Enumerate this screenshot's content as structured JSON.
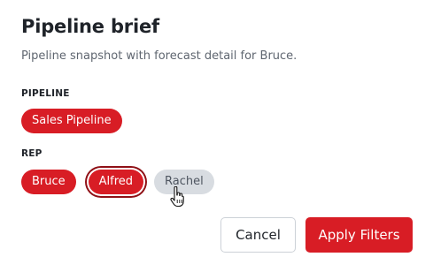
{
  "dialog": {
    "title": "Pipeline brief",
    "subtitle": "Pipeline snapshot with forecast detail for Bruce."
  },
  "pipeline": {
    "label": "PIPELINE",
    "chips": [
      {
        "label": "Sales Pipeline",
        "state": "selected"
      }
    ]
  },
  "rep": {
    "label": "REP",
    "chips": [
      {
        "label": "Bruce",
        "state": "selected"
      },
      {
        "label": "Alfred",
        "state": "selected-focused"
      },
      {
        "label": "Rachel",
        "state": "unselected-hovered"
      }
    ]
  },
  "actions": {
    "cancel_label": "Cancel",
    "apply_label": "Apply Filters"
  },
  "colors": {
    "accent": "#d81d25",
    "chip_unselected": "#d8dce1",
    "focus_ring": "#8f1016"
  },
  "cursor": {
    "icon": "hand-pointer-icon",
    "hovering": "Rachel"
  }
}
